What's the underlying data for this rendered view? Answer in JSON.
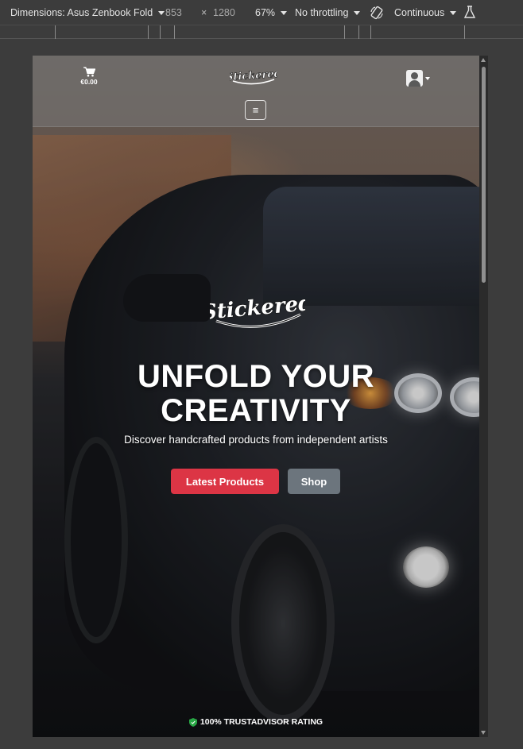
{
  "devtools": {
    "dimensions_label": "Dimensions: Asus Zenbook Fold",
    "width": "853",
    "times": "×",
    "height": "1280",
    "zoom": "67%",
    "throttling": "No throttling",
    "mode": "Continuous"
  },
  "navbar": {
    "cart_total": "€0.00",
    "menu_glyph": "≡"
  },
  "brand": {
    "logo_text": "Stickered"
  },
  "hero": {
    "title_line1": "UNFOLD YOUR",
    "title_line2": "CREATIVITY",
    "subtitle": "Discover handcrafted products from independent artists",
    "primary_button": "Latest Products",
    "secondary_button": "Shop",
    "trust_text": "100% TRUSTADVISOR RATING"
  },
  "colors": {
    "primary": "#dc3545",
    "secondary": "#6c757d",
    "trust_check": "#28a745"
  }
}
